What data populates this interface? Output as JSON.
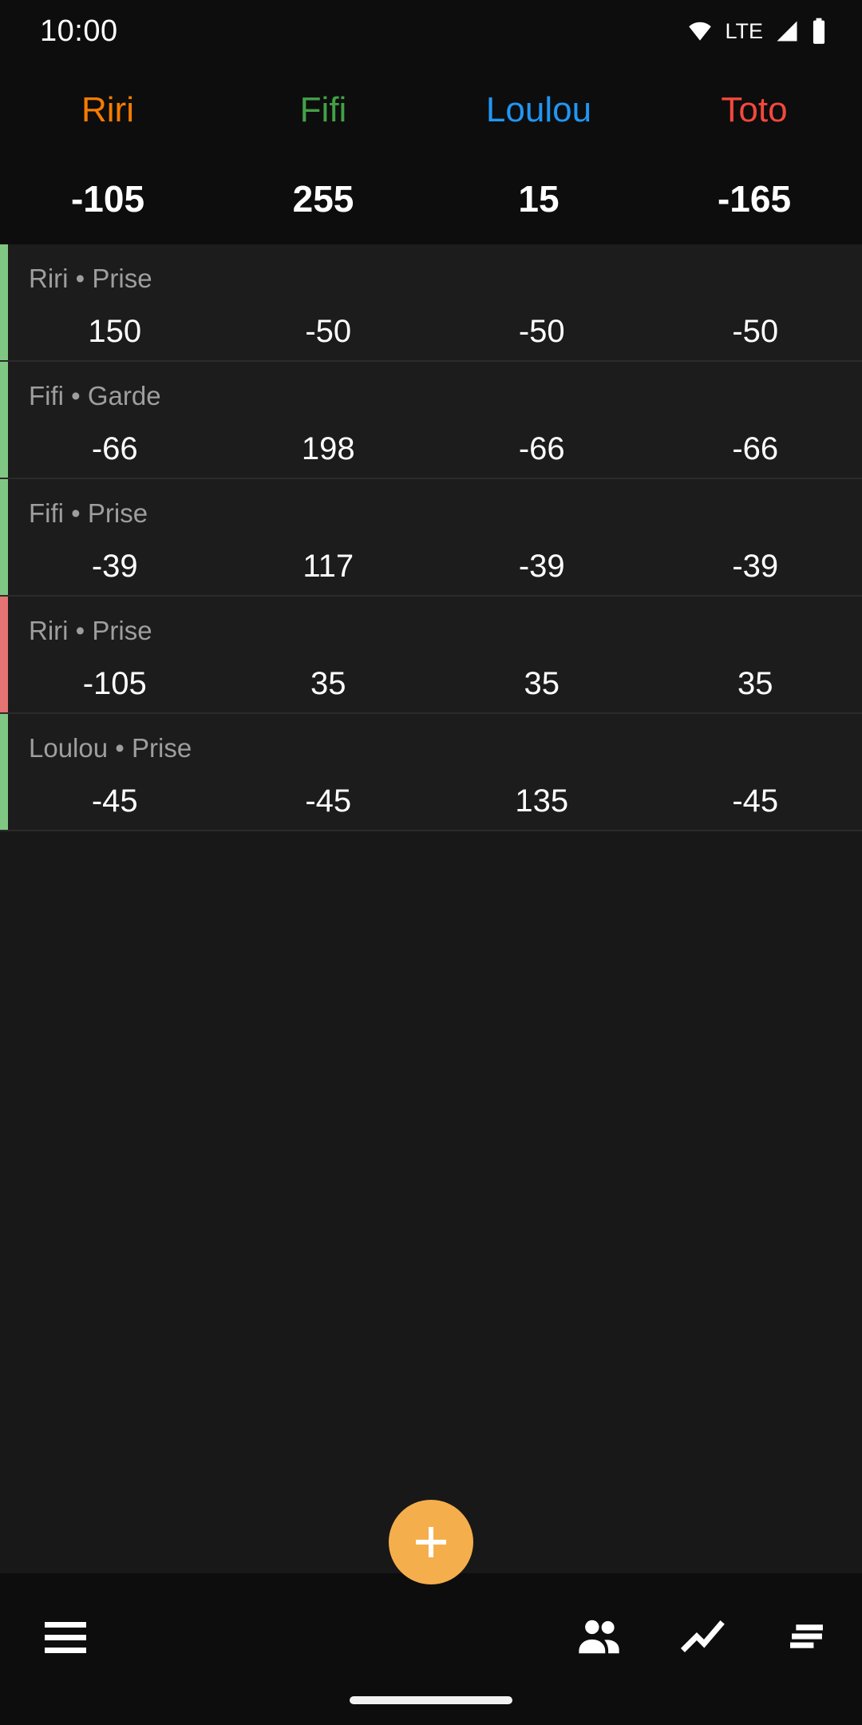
{
  "status_bar": {
    "time": "10:00",
    "network_label": "LTE",
    "icons": [
      "wifi-icon",
      "signal-icon",
      "battery-icon"
    ]
  },
  "header": {
    "players": [
      {
        "name": "Riri",
        "color": "#F57C00",
        "total": "-105"
      },
      {
        "name": "Fifi",
        "color": "#43A047",
        "total": "255"
      },
      {
        "name": "Loulou",
        "color": "#2196F3",
        "total": "15"
      },
      {
        "name": "Toto",
        "color": "#F4483C",
        "total": "-165"
      }
    ]
  },
  "rounds": {
    "accent_colors": {
      "positive": "#81C784",
      "negative": "#E57373"
    },
    "items": [
      {
        "label": "Riri • Prise",
        "taker": "Riri",
        "contract": "Prise",
        "result": "won",
        "accent": "#81C784",
        "values": [
          "150",
          "-50",
          "-50",
          "-50"
        ]
      },
      {
        "label": "Fifi • Garde",
        "taker": "Fifi",
        "contract": "Garde",
        "result": "won",
        "accent": "#81C784",
        "values": [
          "-66",
          "198",
          "-66",
          "-66"
        ]
      },
      {
        "label": "Fifi • Prise",
        "taker": "Fifi",
        "contract": "Prise",
        "result": "won",
        "accent": "#81C784",
        "values": [
          "-39",
          "117",
          "-39",
          "-39"
        ]
      },
      {
        "label": "Riri • Prise",
        "taker": "Riri",
        "contract": "Prise",
        "result": "lost",
        "accent": "#E57373",
        "values": [
          "-105",
          "35",
          "35",
          "35"
        ]
      },
      {
        "label": "Loulou • Prise",
        "taker": "Loulou",
        "contract": "Prise",
        "result": "won",
        "accent": "#81C784",
        "values": [
          "-45",
          "-45",
          "135",
          "-45"
        ]
      }
    ]
  },
  "fab": {
    "label": "+",
    "icon": "plus-icon",
    "color": "#F5AE4C"
  },
  "bottom_nav": {
    "left": {
      "icon": "hamburger-menu-icon"
    },
    "right": [
      {
        "icon": "people-icon"
      },
      {
        "icon": "trending-chart-icon"
      },
      {
        "icon": "sort-list-icon"
      }
    ]
  }
}
